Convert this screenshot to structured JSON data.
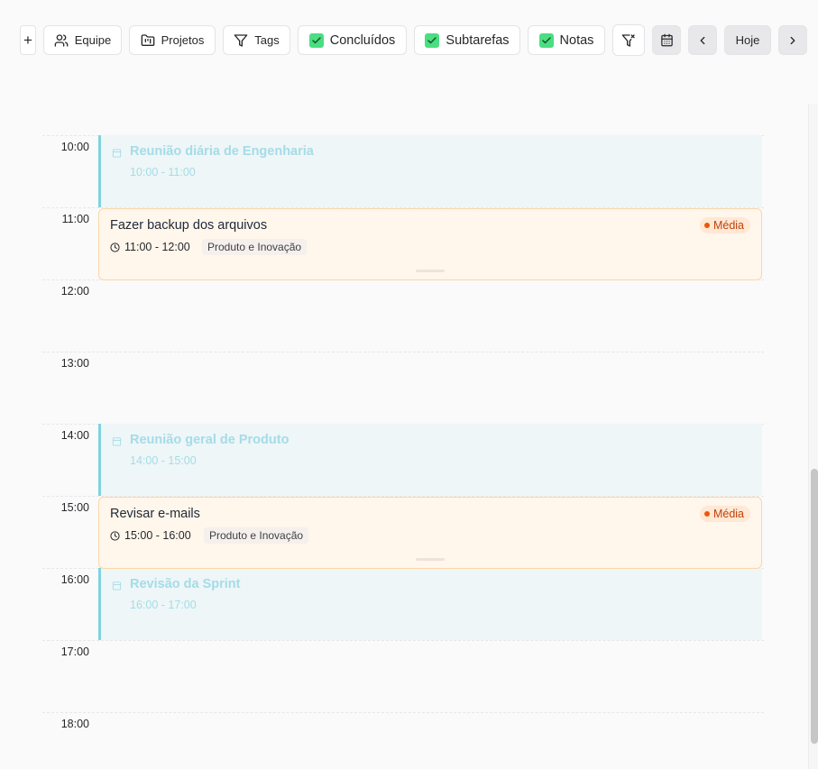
{
  "toolbar": {
    "add_label": "+",
    "team_label": "Equipe",
    "projects_label": "Projetos",
    "tags_label": "Tags",
    "completed_label": "Concluídos",
    "subtasks_label": "Subtarefas",
    "notes_label": "Notas",
    "today_label": "Hoje",
    "completed_checked": true,
    "subtasks_checked": true,
    "notes_checked": true
  },
  "hours": [
    "10:00",
    "11:00",
    "12:00",
    "13:00",
    "14:00",
    "15:00",
    "16:00",
    "17:00",
    "18:00"
  ],
  "meetings": [
    {
      "title": "Reunião diária de Engenharia",
      "time": "10:00 - 11:00"
    },
    {
      "title": "Reunião geral de Produto",
      "time": "14:00 - 15:00"
    },
    {
      "title": "Revisão da Sprint",
      "time": "16:00 - 17:00"
    }
  ],
  "tasks": [
    {
      "title": "Fazer backup dos arquivos",
      "time": "11:00 - 12:00",
      "project": "Produto e Inovação",
      "priority": "Média"
    },
    {
      "title": "Revisar e-mails",
      "time": "15:00 - 16:00",
      "project": "Produto e Inovação",
      "priority": "Média"
    }
  ],
  "colors": {
    "meeting_bg": "#eef6f8",
    "meeting_accent": "#7fd3df",
    "task_bg": "#fff6ec",
    "task_border": "#fbd7a8",
    "priority_text": "#c2410c",
    "check_green": "#4ade80"
  }
}
